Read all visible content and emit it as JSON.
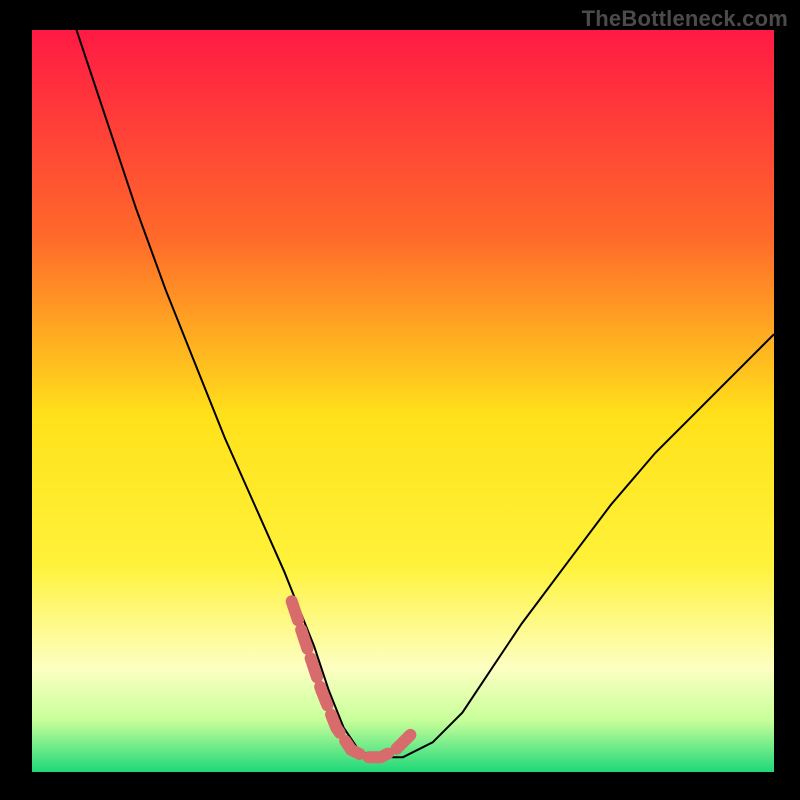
{
  "watermark": "TheBottleneck.com",
  "chart_data": {
    "type": "line",
    "title": "",
    "xlabel": "",
    "ylabel": "",
    "xlim": [
      0,
      100
    ],
    "ylim": [
      0,
      100
    ],
    "gradient_colors": {
      "top": "#ff1a44",
      "upper_mid": "#ff8a1f",
      "mid": "#ffe11a",
      "lower_mid": "#f7ff5a",
      "band_light": "#fdffc2",
      "bottom": "#1fd879"
    },
    "series": [
      {
        "name": "bottleneck-curve",
        "stroke": "#000000",
        "stroke_width": 2,
        "x": [
          6,
          10,
          14,
          18,
          22,
          26,
          30,
          34,
          36,
          38,
          40,
          42,
          44,
          46,
          50,
          54,
          58,
          62,
          66,
          72,
          78,
          84,
          90,
          96,
          100
        ],
        "y": [
          100,
          88,
          76,
          65,
          55,
          45,
          36,
          27,
          22,
          17,
          11,
          6,
          3,
          2,
          2,
          4,
          8,
          14,
          20,
          28,
          36,
          43,
          49,
          55,
          59
        ]
      },
      {
        "name": "highlight-segment",
        "stroke": "#d86b6b",
        "stroke_width": 12,
        "dash": [
          20,
          10
        ],
        "x": [
          35,
          37,
          39,
          41,
          43,
          45,
          47,
          49,
          51
        ],
        "y": [
          23,
          17,
          11,
          6,
          3,
          2,
          2,
          3,
          5
        ]
      }
    ],
    "notes": "V-shaped bottleneck curve on a vertical rainbow gradient; minimum around x≈46 at y≈2. Axis values are normalized 0–100; no tick labels are shown."
  }
}
